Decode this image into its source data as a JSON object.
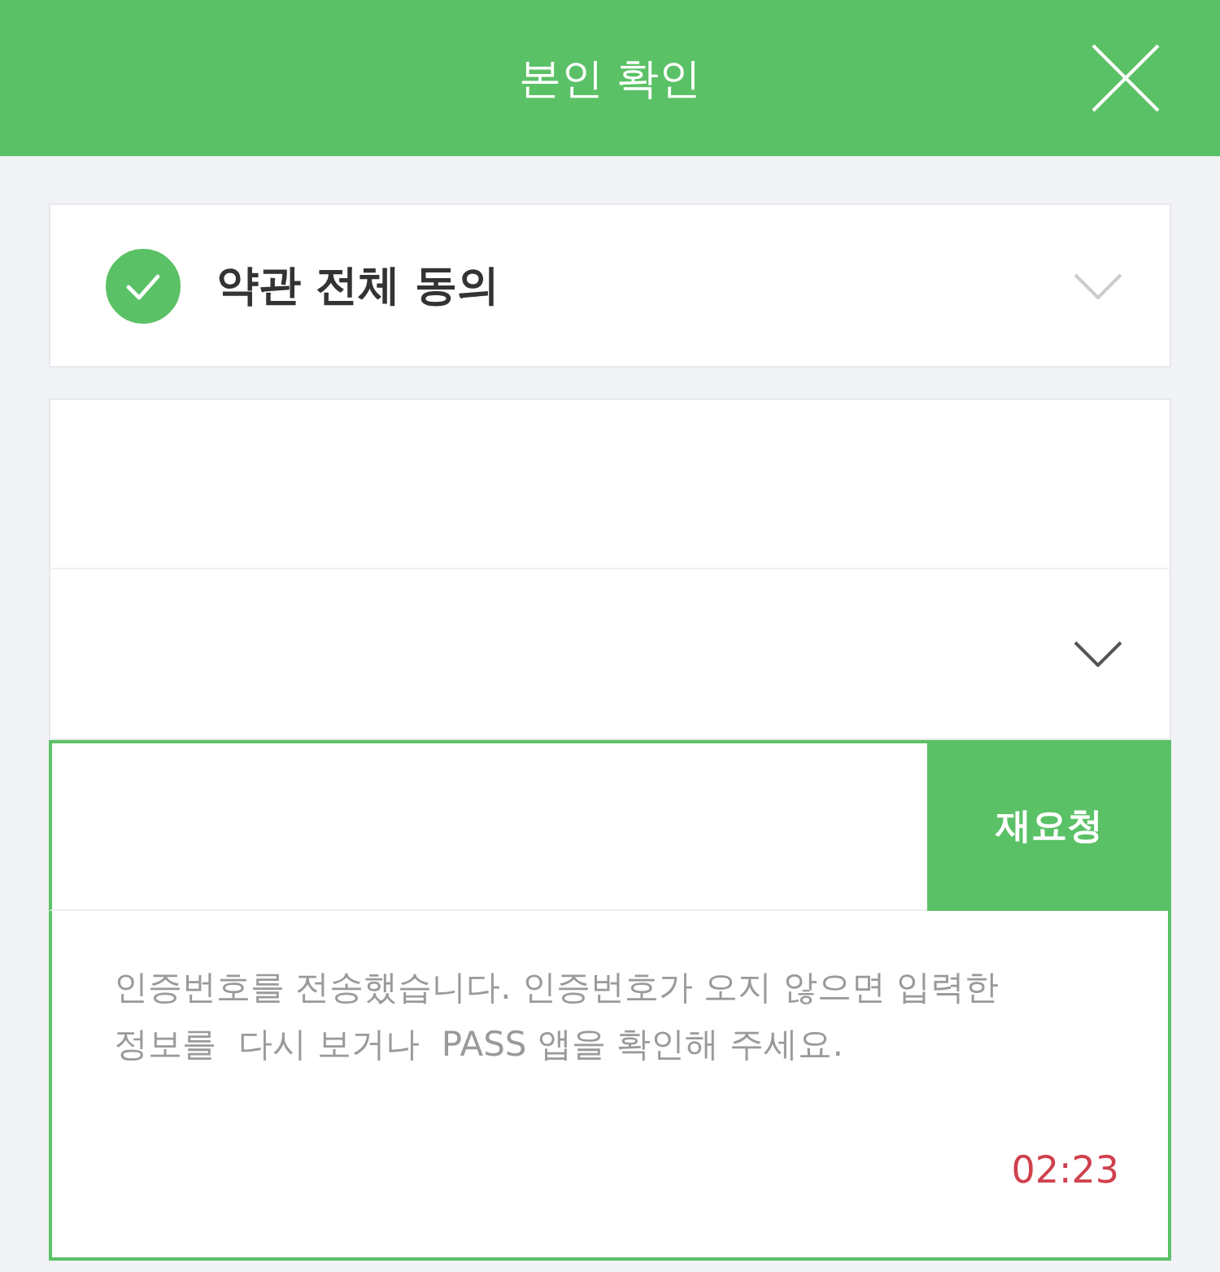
{
  "header": {
    "title": "본인 확인"
  },
  "terms": {
    "label": "약관 전체 동의",
    "checked": true
  },
  "form_fields": [
    {
      "kind": "input"
    },
    {
      "kind": "select"
    }
  ],
  "verification": {
    "button": "재요청",
    "message": "인증번호를 전송했습니다. 인증번호가 오지 않으면 입력한 정보를  다시 보거나  PASS 앱을 확인해 주세요.",
    "timer": "02:23"
  }
}
